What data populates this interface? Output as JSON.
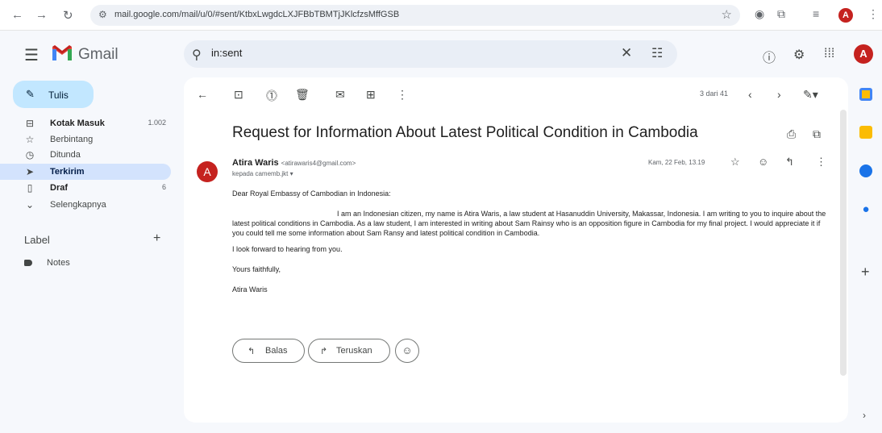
{
  "browser": {
    "url": "mail.google.com/mail/u/0/#sent/KtbxLwgdcLXJFBbTBMTjJKlcfzsMffGSB"
  },
  "header": {
    "app_name": "Gmail",
    "search_value": "in:sent"
  },
  "account": {
    "initial": "A"
  },
  "sidebar": {
    "compose_label": "Tulis",
    "items": [
      {
        "label": "Kotak Masuk",
        "count": "1.002"
      },
      {
        "label": "Berbintang",
        "count": ""
      },
      {
        "label": "Ditunda",
        "count": ""
      },
      {
        "label": "Terkirim",
        "count": ""
      },
      {
        "label": "Draf",
        "count": "6"
      },
      {
        "label": "Selengkapnya",
        "count": ""
      }
    ],
    "labels_heading": "Label",
    "labels": [
      {
        "label": "Notes"
      }
    ]
  },
  "toolbar": {
    "pager": "3 dari 41"
  },
  "email": {
    "subject": "Request for Information About Latest Political Condition in Cambodia",
    "sender_initial": "A",
    "sender_name": "Atira Waris",
    "sender_email": "<atirawaris4@gmail.com>",
    "recipient": "kepada camemb.jkt",
    "date": "Kam, 22 Feb, 13.19",
    "greeting": "Dear Royal Embassy of Cambodian in Indonesia:",
    "paragraph": "I am an Indonesian citizen, my name is Atira Waris, a law student at Hasanuddin University, Makassar, Indonesia. I am writing to you to inquire about the latest political conditions in Cambodia. As a law student, I am interested in writing about Sam Rainsy who is an opposition figure in Cambodia for my final project.  I would appreciate it if you could tell me some information about Sam Ransy and latest political condition in Cambodia.",
    "closing_line": "I look forward to hearing from you.",
    "signoff": "Yours faithfully,",
    "signature": "Atira Waris"
  },
  "actions": {
    "reply_label": "Balas",
    "forward_label": "Teruskan"
  },
  "colors": {
    "accent": "#c2e7ff",
    "active_nav": "#d3e3fd",
    "avatar": "#c5221f"
  }
}
